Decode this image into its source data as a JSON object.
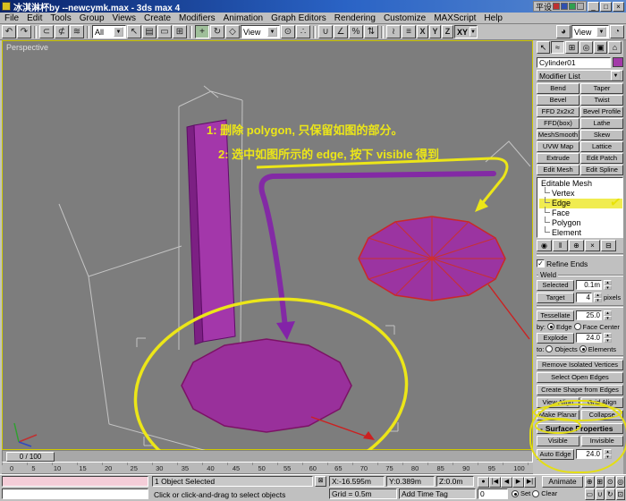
{
  "window": {
    "title": "冰淇淋杯by --newcymk.max - 3ds max 4",
    "ime_text": "平设"
  },
  "menu": {
    "items": [
      "File",
      "Edit",
      "Tools",
      "Group",
      "Views",
      "Create",
      "Modifiers",
      "Animation",
      "Graph Editors",
      "Rendering",
      "Customize",
      "MAXScript",
      "Help"
    ]
  },
  "toolbar": {
    "filter_value": "All",
    "coord_system": "View",
    "render_type_value": "View",
    "axis_x": "X",
    "axis_y": "Y",
    "axis_z": "Z",
    "axis_xy": "XY"
  },
  "viewport": {
    "label": "Perspective",
    "annotation_line1": "1: 删除 polygon, 只保留如图的部分。",
    "annotation_line2": "2: 选中如图所示的 edge, 按下 visible 得到"
  },
  "timeline": {
    "slider_label": "0 / 100",
    "ticks": [
      "0",
      "5",
      "10",
      "15",
      "20",
      "25",
      "30",
      "35",
      "40",
      "45",
      "50",
      "55",
      "60",
      "65",
      "70",
      "75",
      "80",
      "85",
      "90",
      "95",
      "100"
    ]
  },
  "command_panel": {
    "object_name": "Cylinder01",
    "modifier_list_label": "Modifier List",
    "buttons": [
      "Bend",
      "Taper",
      "Bevel",
      "Twist",
      "FFD 2x2x2",
      "Bevel Profile",
      "FFD(box)",
      "Lathe",
      "MeshSmooth",
      "Skew",
      "UVW Map",
      "Lattice",
      "Extrude",
      "Edit Patch",
      "Edit Mesh",
      "Edit Spline"
    ],
    "stack_root": "Editable Mesh",
    "stack_items": [
      "Vertex",
      "Edge",
      "Face",
      "Polygon",
      "Element"
    ],
    "edit_geometry": {
      "refine_ends": "Refine Ends",
      "weld": "Weld",
      "selected": "Selected",
      "selected_value": "0.1m",
      "target": "Target",
      "target_value": "4",
      "pixels": "pixels",
      "tessellate": "Tessellate",
      "tessellate_value": "25.0",
      "by": "by:",
      "edge": "Edge",
      "face_center": "Face Center",
      "explode": "Explode",
      "explode_value": "24.0",
      "to": "to:",
      "objects": "Objects",
      "elements": "Elements",
      "remove_isolated": "Remove Isolated Vertices",
      "select_open": "Select Open Edges",
      "create_shape": "Create Shape from Edges",
      "view_align": "View Align",
      "grid_align": "Grid Align",
      "make_planar": "Make Planar",
      "collapse": "Collapse"
    },
    "surface_properties": {
      "title": "Surface Properties",
      "visible": "Visible",
      "invisible": "Invisible",
      "auto_edge": "Auto Edge",
      "auto_edge_value": "24.0"
    }
  },
  "status": {
    "selected": "1 Object Selected",
    "prompt": "Click or click-and-drag to select objects",
    "x": "X:-16.595m",
    "y": "Y:0.389m",
    "z": "Z:0.0m",
    "grid": "Grid = 0.5m",
    "add_time_tag": "Add Time Tag",
    "animate": "Animate",
    "time_field": "0",
    "set_label": "Set",
    "clear_label": "Clear"
  },
  "glyphs": {
    "undo": "↶",
    "redo": "↷",
    "link": "⊂",
    "unlink": "⊄",
    "bind": "≋",
    "select": "↖",
    "select_by_name": "▤",
    "region_rect": "▭",
    "window_crossing": "⊞",
    "move": "+",
    "rotate": "↻",
    "scale": "◇",
    "pivot_center": "⊙",
    "manipulate": "∴",
    "snap_3d": "∪",
    "snap_angle": "∠",
    "snap_percent": "%",
    "spinner_snap": "⇅",
    "mirror": "≀",
    "align": "≡",
    "render_scene": "◕",
    "quick_render": "◔",
    "dropdown": "▼",
    "spin_up": "▴",
    "spin_down": "▾",
    "tab_create": "↖",
    "tab_modify": "≈",
    "tab_hierarchy": "⊞",
    "tab_motion": "◎",
    "tab_display": "▣",
    "tab_utilities": "⌂",
    "pin_stack": "◉",
    "show_end_result": "‖",
    "make_unique": "⊕",
    "remove_modifier": "×",
    "configure": "⊟",
    "lock_selection": "⊠",
    "go_start": "|◀",
    "prev_frame": "◀",
    "play": "▶",
    "go_end": "▶|",
    "key_mode": "●",
    "zoom": "⊕",
    "zoom_all": "⊞",
    "zoom_extents": "⊙",
    "zoom_extents_all": "◎",
    "zoom_region": "▭",
    "pan": "∪",
    "arc_rotate": "↻",
    "min_max_toggle": "⊡",
    "check": "✓",
    "minus": "-",
    "minimize": "_",
    "maximize": "□",
    "close": "×"
  },
  "colors": {
    "titlebar_blue": "#0a246a",
    "panel_gray": "#c0c0c0",
    "viewport_gray": "#7d7d7d",
    "selection_purple": "#9b34a1",
    "edge_red": "#c92828",
    "annotation_yellow": "#ece618",
    "stack_highlight": "#f0ec50",
    "active_viewport_border": "#cfc900"
  }
}
